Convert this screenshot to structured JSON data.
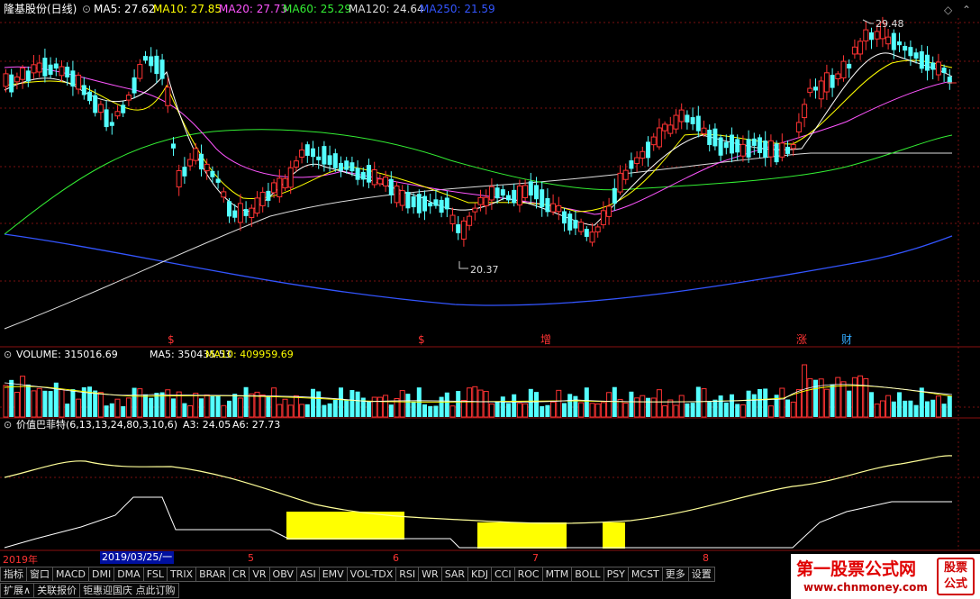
{
  "header": {
    "stock": "隆基股份(日线)",
    "ma": [
      {
        "label": "MA5: 27.62",
        "color": "#ffffff"
      },
      {
        "label": "MA10: 27.85",
        "color": "#ffff00"
      },
      {
        "label": "MA20: 27.73",
        "color": "#ff55ff"
      },
      {
        "label": "MA60: 25.29",
        "color": "#33ee33"
      },
      {
        "label": "MA120: 24.64",
        "color": "#dddddd"
      },
      {
        "label": "MA250: 21.59",
        "color": "#3355ff"
      }
    ]
  },
  "annotations": {
    "high": "29.48",
    "low": "20.37",
    "events": [
      {
        "text": "$",
        "color": "#ff3333"
      },
      {
        "text": "$",
        "color": "#ff3333"
      },
      {
        "text": "增",
        "color": "#ff3333"
      },
      {
        "text": "涨",
        "color": "#ff3333"
      },
      {
        "text": "财",
        "color": "#33aaff"
      }
    ]
  },
  "volume": {
    "label": "VOLUME: 315016.69",
    "ma5": "MA5: 350435.53",
    "ma10": "MA10: 409959.69"
  },
  "indicator": {
    "label": "价值巴菲特(6,13,13,24,80,3,10,6)",
    "a3": "A3: 24.05",
    "a6": "A6: 27.73"
  },
  "dates": {
    "year": "2019年",
    "selected": "2019/03/25/一",
    "months": [
      "5",
      "6",
      "7",
      "8"
    ]
  },
  "toolbar": {
    "row1": [
      "指标",
      "窗口",
      "MACD",
      "DMI",
      "DMA",
      "FSL",
      "TRIX",
      "BRAR",
      "CR",
      "VR",
      "OBV",
      "ASI",
      "EMV",
      "VOL-TDX",
      "RSI",
      "WR",
      "SAR",
      "KDJ",
      "CCI",
      "ROC",
      "MTM",
      "BOLL",
      "PSY",
      "MCST",
      "更多",
      "设置"
    ],
    "row2": [
      "扩展∧",
      "关联报价",
      "钜惠迎国庆 点此订购"
    ]
  },
  "brand": {
    "name": "第一股票公式网",
    "url": "www.chnmoney.com",
    "stamp1": "股票",
    "stamp2": "公式"
  },
  "colors": {
    "up": "#ff3333",
    "down": "#54ffff",
    "bg": "#000000",
    "ma5": "#ffffff",
    "ma10": "#ffff00",
    "ma20": "#ff55ff",
    "ma60": "#33ee33",
    "ma120": "#dddddd",
    "ma250": "#3355ff"
  }
}
